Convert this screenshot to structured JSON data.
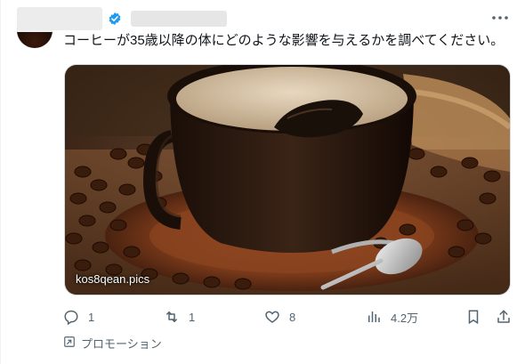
{
  "tweet": {
    "text": "コーヒーが35歳以降の体にどのような影響を与えるかを調べてください。",
    "media_source": "kos8qean.pics"
  },
  "actions": {
    "reply_count": "1",
    "retweet_count": "1",
    "like_count": "8",
    "view_count": "4.2万"
  },
  "promo": {
    "label": "プロモーション"
  },
  "colors": {
    "verified": "#1d9bf0",
    "muted": "#536471",
    "text": "#0f1419"
  },
  "icons": [
    "verified-badge-icon",
    "more-icon",
    "reply-icon",
    "retweet-icon",
    "like-icon",
    "views-icon",
    "bookmark-icon",
    "share-icon",
    "promoted-icon"
  ]
}
